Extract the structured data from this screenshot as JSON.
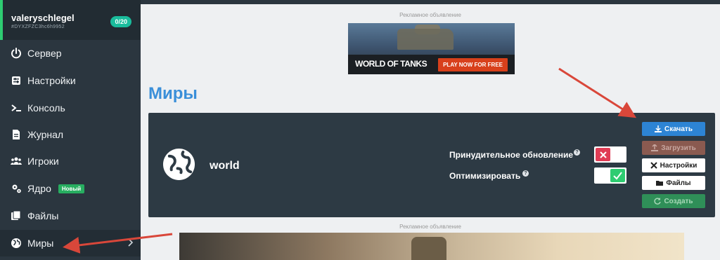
{
  "user": {
    "name": "valeryschlegel",
    "code": "#DYXZFZC3hc6h9952",
    "slots": "0/20"
  },
  "sidebar": {
    "items": [
      {
        "label": "Сервер",
        "icon": "power-icon"
      },
      {
        "label": "Настройки",
        "icon": "sliders-icon"
      },
      {
        "label": "Консоль",
        "icon": "terminal-icon"
      },
      {
        "label": "Журнал",
        "icon": "document-icon"
      },
      {
        "label": "Игроки",
        "icon": "users-icon"
      },
      {
        "label": "Ядро",
        "icon": "gears-icon",
        "badge": "Новый"
      },
      {
        "label": "Файлы",
        "icon": "folders-icon"
      },
      {
        "label": "Миры",
        "icon": "globe-icon"
      }
    ]
  },
  "ads": {
    "label": "Рекламное объявление",
    "banner_title": "WORLD OF TANKS",
    "banner_cta": "PLAY NOW FOR FREE"
  },
  "main": {
    "title": "Миры",
    "world": {
      "name": "world",
      "forced_update_label": "Принудительное обновление",
      "forced_update_on": false,
      "optimize_label": "Оптимизировать",
      "optimize_on": true
    },
    "buttons": {
      "download": "Скачать",
      "upload": "Загрузить",
      "settings": "Настройки",
      "files": "Файлы",
      "create": "Создать"
    }
  },
  "colors": {
    "accent_blue": "#3a8fd9",
    "sidebar": "#2b363f",
    "panel": "#2d3a44",
    "green": "#2ecc71",
    "red": "#e03c55",
    "arrow": "#d9473a"
  }
}
